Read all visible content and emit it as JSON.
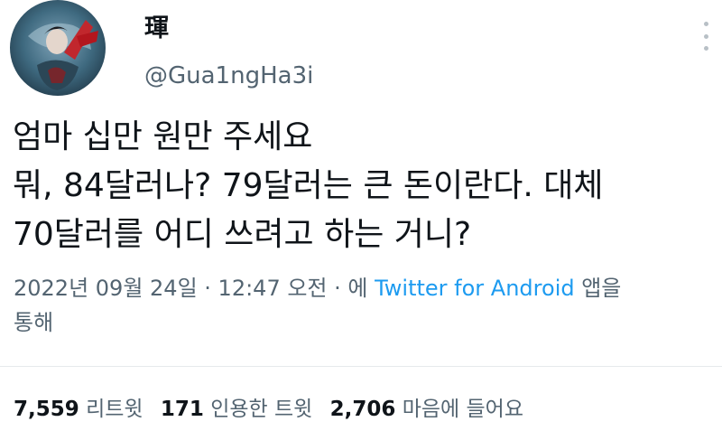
{
  "user": {
    "display_name": "琿",
    "handle": "@Gua1ngHa3i"
  },
  "tweet": {
    "lines": [
      "엄마 십만 원만 주세요",
      "뭐, 84달러나? 79달러는 큰 돈이란다. 대체",
      "70달러를 어디 쓰려고 하는 거니?"
    ]
  },
  "meta": {
    "date": "2022년 09월 24일",
    "separator1": " · ",
    "time": "12:47 오전",
    "separator2": " · ",
    "via_prefix": "에 ",
    "source": "Twitter for Android",
    "via_suffix_line1": " 앱을",
    "via_suffix_line2": "통해"
  },
  "stats": {
    "retweets_count": "7,559",
    "retweets_label": "리트윗",
    "quotes_count": "171",
    "quotes_label": "인용한 트윗",
    "likes_count": "2,706",
    "likes_label": "마음에 들어요"
  },
  "icons": {
    "more": "more-vertical-icon"
  }
}
